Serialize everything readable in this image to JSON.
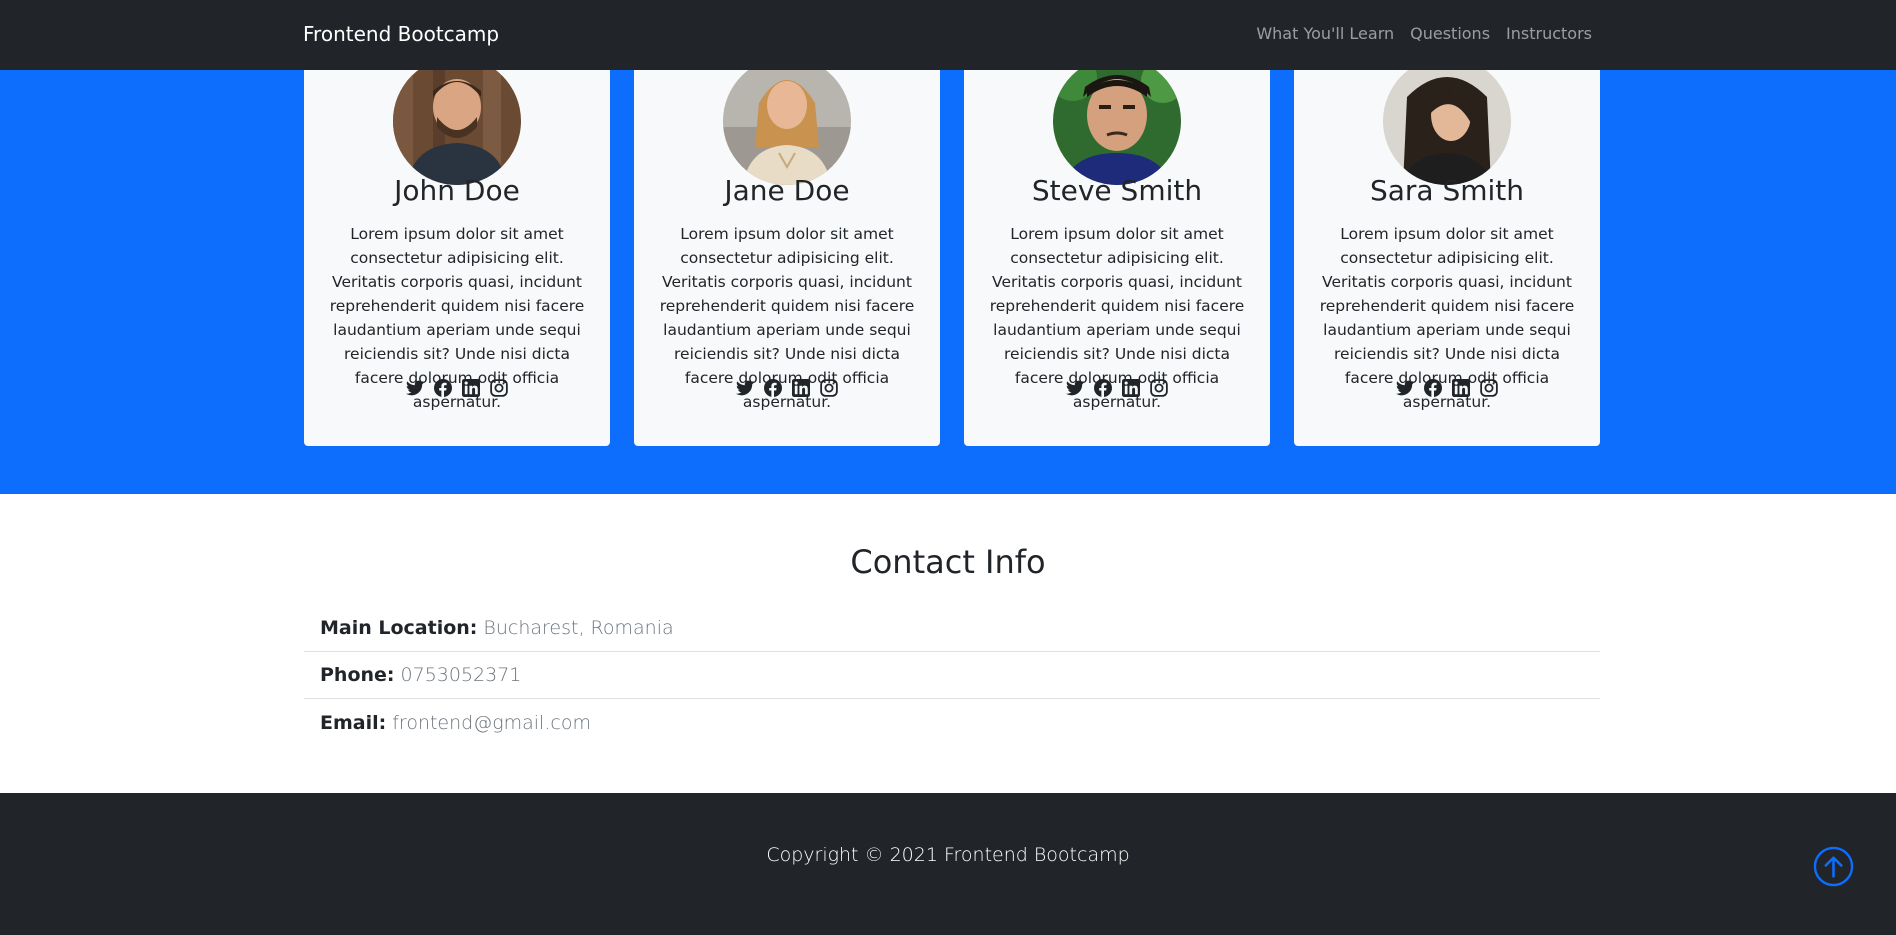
{
  "navbar": {
    "brand": "Frontend Bootcamp",
    "links": [
      "What You'll Learn",
      "Questions",
      "Instructors"
    ]
  },
  "instructors": [
    {
      "name": "John Doe",
      "bio": "Lorem ipsum dolor sit amet consectetur adipisicing elit. Veritatis corporis quasi, incidunt reprehenderit quidem nisi facere laudantium aperiam unde sequi reiciendis sit? Unde nisi dicta facere dolorum odit officia aspernatur."
    },
    {
      "name": "Jane Doe",
      "bio": "Lorem ipsum dolor sit amet consectetur adipisicing elit. Veritatis corporis quasi, incidunt reprehenderit quidem nisi facere laudantium aperiam unde sequi reiciendis sit? Unde nisi dicta facere dolorum odit officia aspernatur."
    },
    {
      "name": "Steve Smith",
      "bio": "Lorem ipsum dolor sit amet consectetur adipisicing elit. Veritatis corporis quasi, incidunt reprehenderit quidem nisi facere laudantium aperiam unde sequi reiciendis sit? Unde nisi dicta facere dolorum odit officia aspernatur."
    },
    {
      "name": "Sara Smith",
      "bio": "Lorem ipsum dolor sit amet consectetur adipisicing elit. Veritatis corporis quasi, incidunt reprehenderit quidem nisi facere laudantium aperiam unde sequi reiciendis sit? Unde nisi dicta facere dolorum odit officia aspernatur."
    }
  ],
  "social_icons": [
    "twitter-icon",
    "facebook-icon",
    "linkedin-icon",
    "instagram-icon"
  ],
  "contact": {
    "title": "Contact Info",
    "items": [
      {
        "label": "Main Location:",
        "value": "Bucharest, Romania"
      },
      {
        "label": "Phone:",
        "value": "0753052371"
      },
      {
        "label": "Email:",
        "value": "frontend@gmail.com"
      }
    ]
  },
  "footer": {
    "copyright": "Copyright © 2021 Frontend Bootcamp",
    "back_to_top_icon": "arrow-up-circle-icon"
  },
  "colors": {
    "primary": "#0d6efd",
    "dark": "#212529",
    "card_bg": "#f8f9fa",
    "muted": "#6c757d"
  }
}
